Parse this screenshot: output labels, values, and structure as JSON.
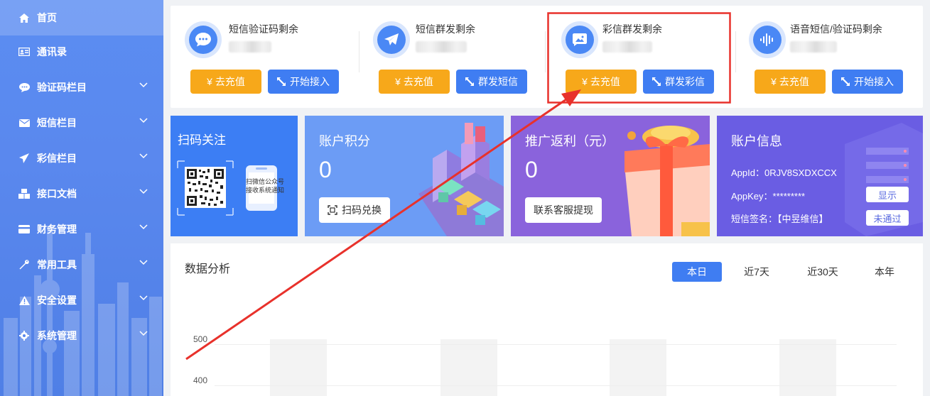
{
  "sidebar": {
    "items": [
      {
        "label": "首页",
        "icon": "home-icon",
        "active": true
      },
      {
        "label": "通讯录",
        "icon": "contact-card-icon"
      },
      {
        "label": "验证码栏目",
        "icon": "chat-bubble-icon"
      },
      {
        "label": "短信栏目",
        "icon": "envelope-icon"
      },
      {
        "label": "彩信栏目",
        "icon": "paper-plane-icon"
      },
      {
        "label": "接口文档",
        "icon": "cubes-icon"
      },
      {
        "label": "财务管理",
        "icon": "credit-card-icon"
      },
      {
        "label": "常用工具",
        "icon": "wrench-icon"
      },
      {
        "label": "安全设置",
        "icon": "warning-icon"
      },
      {
        "label": "系统管理",
        "icon": "gear-icon"
      }
    ]
  },
  "balances": [
    {
      "title": "短信验证码剩余",
      "icon": "chat-dots-icon",
      "btn1": "¥ 去充值",
      "btn2": "开始接入"
    },
    {
      "title": "短信群发剩余",
      "icon": "telegram-plane-icon",
      "btn1": "¥ 去充值",
      "btn2": "群发短信"
    },
    {
      "title": "彩信群发剩余",
      "icon": "image-message-icon",
      "btn1": "¥ 去充值",
      "btn2": "群发彩信"
    },
    {
      "title": "语音短信/验证码剩余",
      "icon": "sound-wave-icon",
      "btn1": "¥ 去充值",
      "btn2": "开始接入"
    }
  ],
  "cards": {
    "qr": {
      "title": "扫码关注",
      "hint_line1": "扫微信公众号",
      "hint_line2": "接收系统通知"
    },
    "points": {
      "title": "账户积分",
      "value": "0",
      "button": "扫码兑换"
    },
    "rebate": {
      "title": "推广返利（元）",
      "value": "0",
      "button": "联系客服提现"
    },
    "account": {
      "title": "账户信息",
      "appid": "AppId：0RJV8SXDXCCX",
      "appkey": "AppKey：*********",
      "sign": "短信签名：【中昱维信】",
      "show_btn": "显示",
      "status_btn": "未通过"
    }
  },
  "analytics": {
    "title": "数据分析",
    "ranges": [
      "本日",
      "近7天",
      "近30天",
      "本年"
    ],
    "active_range": "本日",
    "yticks": [
      "500",
      "400"
    ]
  },
  "colors": {
    "primary": "#3f7df2",
    "orange": "#f7a81a",
    "highlight": "#e8312b"
  }
}
